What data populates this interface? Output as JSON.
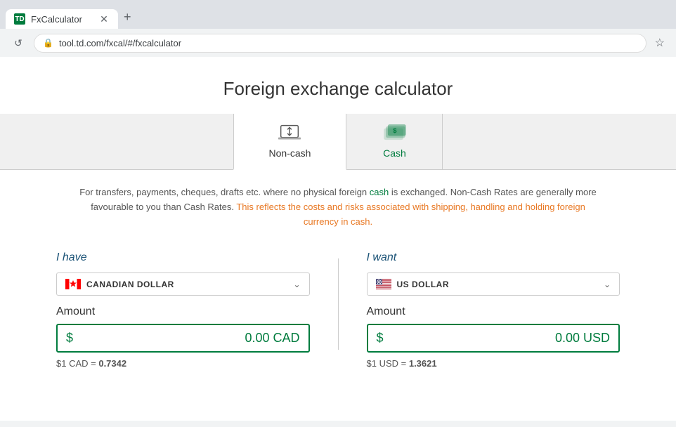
{
  "browser": {
    "tab_title": "FxCalculator",
    "url": "tool.td.com/fxcal/#/fxcalculator",
    "new_tab_label": "+",
    "close_label": "✕"
  },
  "page": {
    "title": "Foreign exchange calculator"
  },
  "tabs": [
    {
      "id": "non-cash",
      "label": "Non-cash",
      "active": true
    },
    {
      "id": "cash",
      "label": "Cash",
      "active": false
    }
  ],
  "description": {
    "text1": "For transfers, payments, cheques, drafts etc. where no physical foreign ",
    "text2": "cash",
    "text3": " is exchanged. Non-Cash Rates are generally more favourable to you than Cash Rates. ",
    "text4": "This reflects the costs and risks associated with shipping, handling and holding foreign currency in cash.",
    "text5": ""
  },
  "left_panel": {
    "have_label": "I have",
    "currency_name": "CANADIAN DOLLAR",
    "amount_label": "Amount",
    "dollar_sign": "$",
    "amount_value": "0.00  CAD",
    "rate_prefix": "$1 CAD = ",
    "rate_value": "0.7342"
  },
  "right_panel": {
    "want_label": "I want",
    "currency_name": "US DOLLAR",
    "amount_label": "Amount",
    "dollar_sign": "$",
    "amount_value": "0.00  USD",
    "rate_prefix": "$1 USD = ",
    "rate_value": "1.3621"
  }
}
